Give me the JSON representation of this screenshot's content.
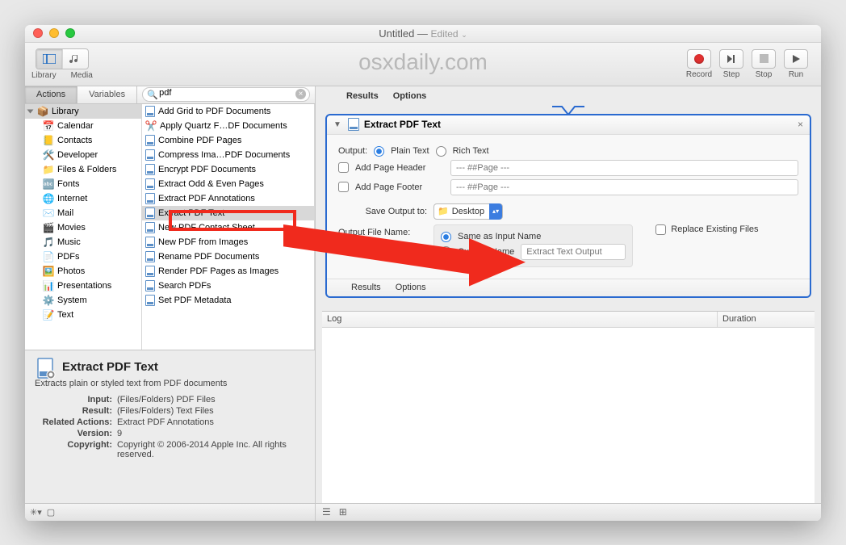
{
  "title": {
    "name": "Untitled",
    "editedLabel": "Edited"
  },
  "watermark": "osxdaily.com",
  "toolbar": {
    "libraryLabel": "Library",
    "mediaLabel": "Media",
    "recordLabel": "Record",
    "stepLabel": "Step",
    "stopLabel": "Stop",
    "runLabel": "Run"
  },
  "tabs": {
    "actions": "Actions",
    "variables": "Variables"
  },
  "search": {
    "value": "pdf"
  },
  "library": {
    "root": "Library",
    "items": [
      "Calendar",
      "Contacts",
      "Developer",
      "Files & Folders",
      "Fonts",
      "Internet",
      "Mail",
      "Movies",
      "Music",
      "PDFs",
      "Photos",
      "Presentations",
      "System",
      "Text"
    ]
  },
  "actions": [
    "Add Grid to PDF Documents",
    "Apply Quartz F…DF Documents",
    "Combine PDF Pages",
    "Compress Ima…PDF Documents",
    "Encrypt PDF Documents",
    "Extract Odd & Even Pages",
    "Extract PDF Annotations",
    "Extract PDF Text",
    "New PDF Contact Sheet",
    "New PDF from Images",
    "Rename PDF Documents",
    "Render PDF Pages as Images",
    "Search PDFs",
    "Set PDF Metadata"
  ],
  "info": {
    "title": "Extract PDF Text",
    "desc": "Extracts plain or styled text from PDF documents",
    "rows": [
      [
        "Input:",
        "(Files/Folders) PDF Files"
      ],
      [
        "Result:",
        "(Files/Folders) Text Files"
      ],
      [
        "Related Actions:",
        "Extract PDF Annotations"
      ],
      [
        "Version:",
        "9"
      ],
      [
        "Copyright:",
        "Copyright © 2006-2014 Apple Inc. All rights reserved."
      ]
    ]
  },
  "workflowTabs": {
    "results": "Results",
    "options": "Options"
  },
  "action": {
    "title": "Extract PDF Text",
    "outputLabel": "Output:",
    "plain": "Plain Text",
    "rich": "Rich Text",
    "addHeader": "Add Page Header",
    "addFooter": "Add Page Footer",
    "pagePh": "--- ##Page ---",
    "saveTo": "Save Output to:",
    "saveTarget": "Desktop",
    "fileNameLabel": "Output File Name:",
    "sameName": "Same as Input Name",
    "customName": "Custom Name",
    "customPh": "Extract Text Output",
    "replace": "Replace Existing Files",
    "footResults": "Results",
    "footOptions": "Options"
  },
  "log": {
    "col1": "Log",
    "col2": "Duration"
  }
}
